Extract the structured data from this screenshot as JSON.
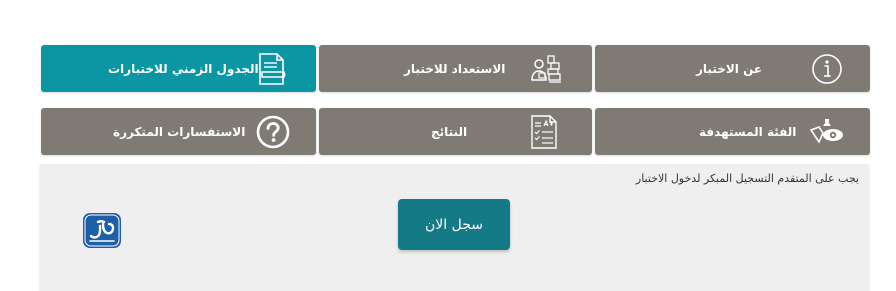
{
  "colors": {
    "teal": "#0c96a3",
    "gray_tile": "#7f7a73",
    "panel_bg": "#efefef",
    "button": "#147a85",
    "logo_blue": "#1f5fa8"
  },
  "tiles": {
    "schedule": {
      "label": "الجدول الزمني للاختبارات",
      "icon": "document-pen-icon"
    },
    "preparation": {
      "label": "الاستعداد للاختبار",
      "icon": "person-books-icon"
    },
    "about": {
      "label": "عن الاختبار",
      "icon": "info-circle-icon"
    },
    "faq": {
      "label": "الاستفسارات المتكررة",
      "icon": "question-circle-icon"
    },
    "results": {
      "label": "النتائج",
      "icon": "graded-paper-icon"
    },
    "audience": {
      "label": "الفئة المستهدفة",
      "icon": "target-audience-icon"
    }
  },
  "panel": {
    "notice": "يجب على المتقدم التسجيل المبكر لدخول الاختبار",
    "register_button": "سجل الان",
    "logo_text": "المرجع"
  }
}
